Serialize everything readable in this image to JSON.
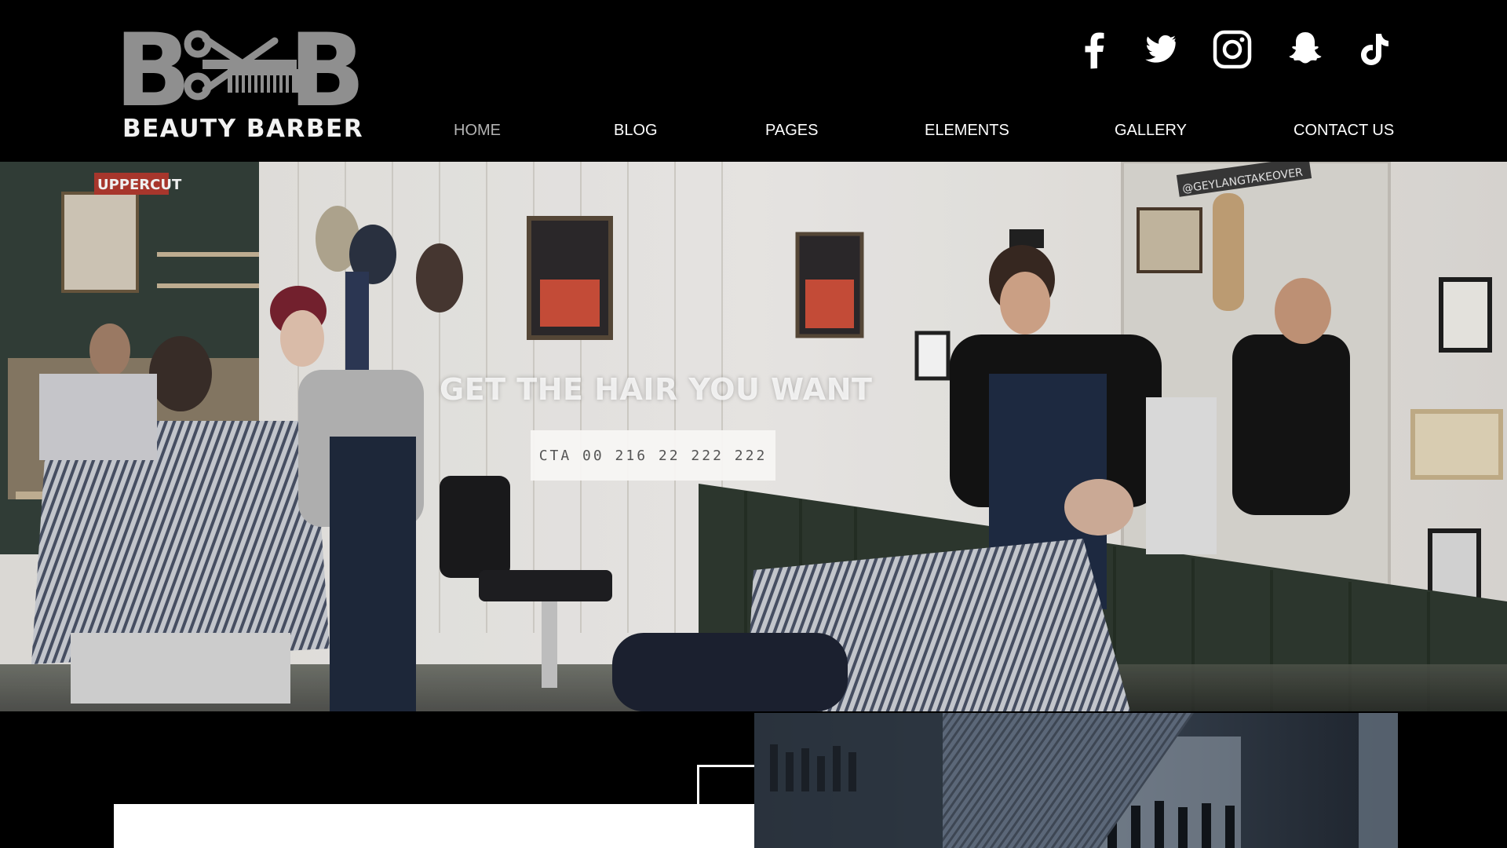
{
  "brand": {
    "initials_left": "B",
    "initials_right": "B",
    "name": "BEAUTY BARBER",
    "accent": "#8f8f8f"
  },
  "social": [
    {
      "icon": "facebook-icon"
    },
    {
      "icon": "twitter-icon"
    },
    {
      "icon": "instagram-icon"
    },
    {
      "icon": "snapchat-icon"
    },
    {
      "icon": "tiktok-icon"
    }
  ],
  "nav": {
    "items": [
      "HOME",
      "BLOG",
      "PAGES",
      "ELEMENTS",
      "GALLERY",
      "CONTACT US"
    ],
    "active": "HOME"
  },
  "hero": {
    "title": "GET THE HAIR YOU WANT",
    "cta_label": "CTA 00 216 22 222 222",
    "sign_left": "UPPERCUT",
    "sign_right": "@GEYLANGTAKEOVER"
  },
  "colors": {
    "background": "#000000",
    "nav_text": "#ffffff",
    "nav_active": "#b3b3b3"
  }
}
